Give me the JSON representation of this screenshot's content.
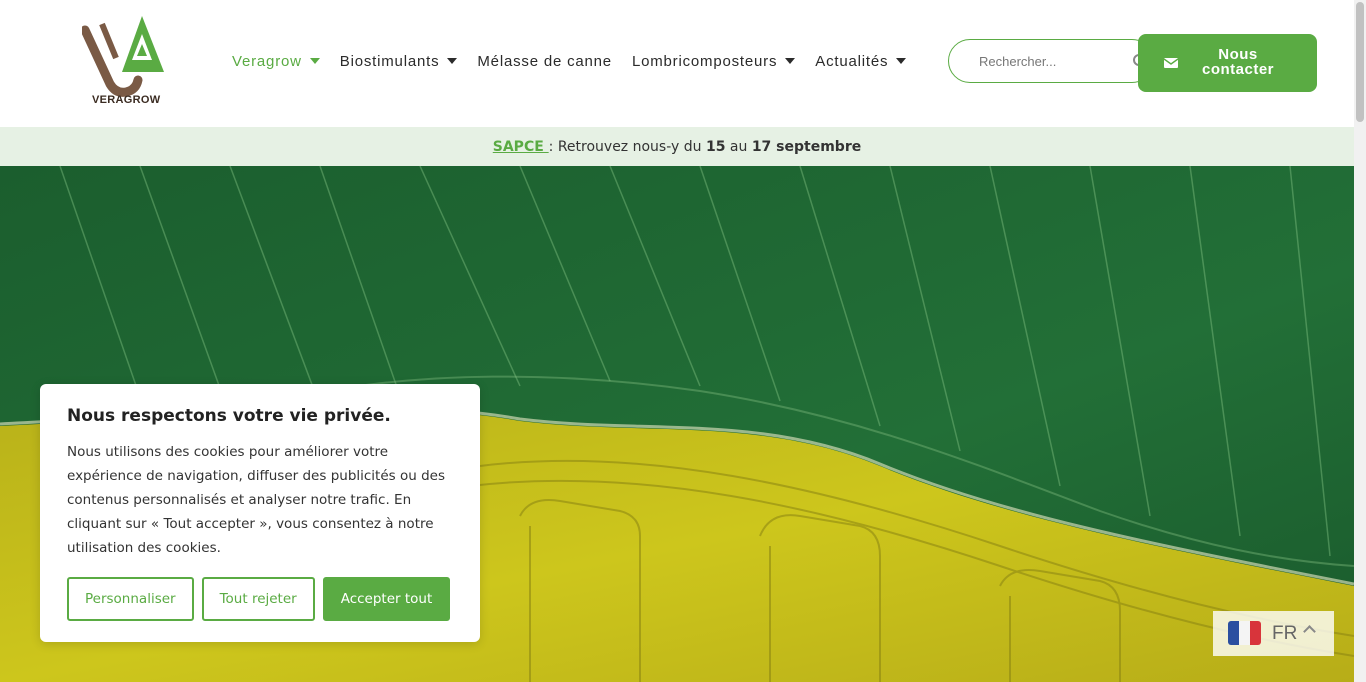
{
  "header": {
    "logo_alt": "VERAGROW",
    "logo_text": "VERAGROW",
    "nav": [
      {
        "label": "Veragrow",
        "dropdown": true,
        "active": true
      },
      {
        "label": "Biostimulants",
        "dropdown": true,
        "active": false
      },
      {
        "label": "Mélasse de canne",
        "dropdown": false,
        "active": false
      },
      {
        "label": "Lombricomposteurs",
        "dropdown": true,
        "active": false
      },
      {
        "label": "Actualités",
        "dropdown": true,
        "active": false
      }
    ],
    "search": {
      "placeholder": "Rechercher..."
    },
    "contact_label": "Nous contacter",
    "contact_icon": "envelope-icon"
  },
  "announcement": {
    "link": "SAPCE ",
    "text_before": ": Retrouvez nous-y du ",
    "day_start": "15",
    "text_mid": " au ",
    "day_end": "17 septembre"
  },
  "cookie": {
    "title": "Nous respectons votre vie privée.",
    "body": "Nous utilisons des cookies pour améliorer votre expérience de navigation, diffuser des publicités ou des contenus personnalisés et analyser notre trafic. En cliquant sur « Tout accepter », vous consentez à notre utilisation des cookies.",
    "btn_customize": "Personnaliser",
    "btn_reject": "Tout rejeter",
    "btn_accept": "Accepter tout"
  },
  "language": {
    "code": "FR",
    "flag": "france-flag"
  },
  "colors": {
    "brand_green": "#5aab43",
    "announce_bg": "#e6f1e4",
    "field_green": "#1f6b32",
    "field_yellow": "#c7c216"
  }
}
